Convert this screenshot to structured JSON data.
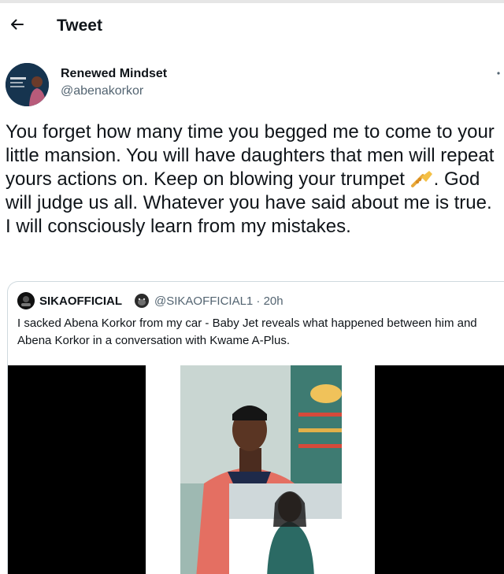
{
  "header": {
    "title": "Tweet"
  },
  "author": {
    "display_name": "Renewed Mindset",
    "handle": "@abenakorkor"
  },
  "tweet": {
    "text_part1": "You forget how many time you begged me to come to your little mansion. You will have daughters that men will repeat yours actions on. Keep on blowing your trumpet ",
    "text_part2": ". God will judge us all. Whatever you have said about me is true. I will consciously learn from my mistakes."
  },
  "quoted_tweet": {
    "display_name": "SIKAOFFICIAL",
    "handle_time": "@SIKAOFFICIAL1 · 20h",
    "text": "I sacked Abena Korkor from my car - Baby Jet reveals what happened between him and Abena Korkor in a conversation with Kwame A-Plus."
  },
  "icons": {
    "back": "arrow-left-icon",
    "more": "more-icon",
    "trumpet": "trumpet-emoji-icon",
    "gorilla": "gorilla-emoji-icon"
  },
  "colors": {
    "text_primary": "#0f1419",
    "text_secondary": "#536471",
    "border": "#cfd9de"
  }
}
